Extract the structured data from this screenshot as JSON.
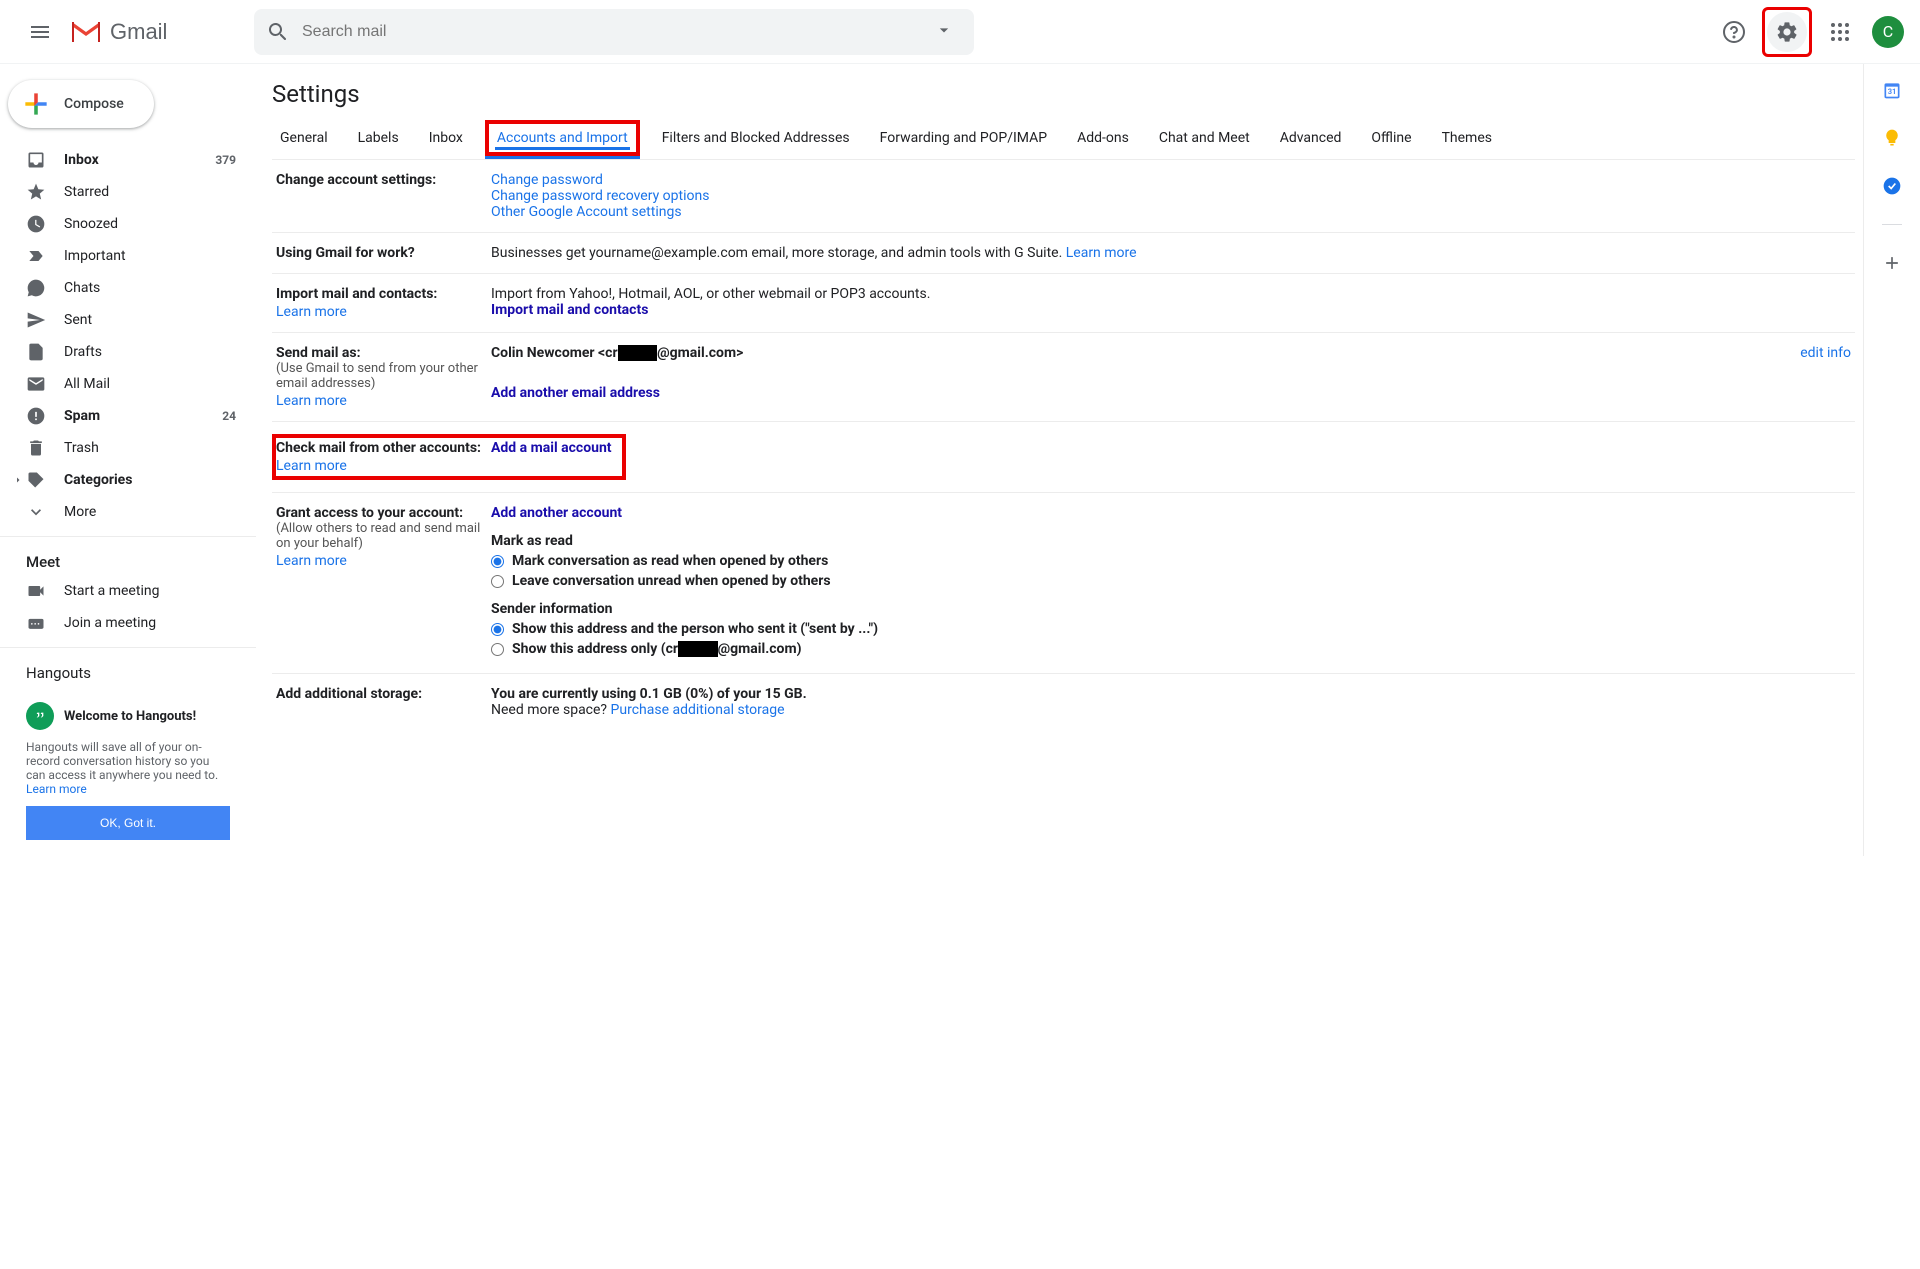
{
  "header": {
    "logo_text": "Gmail",
    "search_placeholder": "Search mail",
    "avatar_initial": "C"
  },
  "sidebar": {
    "compose": "Compose",
    "items": [
      {
        "label": "Inbox",
        "count": "379",
        "bold": true
      },
      {
        "label": "Starred"
      },
      {
        "label": "Snoozed"
      },
      {
        "label": "Important"
      },
      {
        "label": "Chats"
      },
      {
        "label": "Sent"
      },
      {
        "label": "Drafts"
      },
      {
        "label": "All Mail"
      },
      {
        "label": "Spam",
        "count": "24",
        "bold": true
      },
      {
        "label": "Trash"
      },
      {
        "label": "Categories",
        "bold": true,
        "expandable": true
      },
      {
        "label": "More",
        "expandable": true
      }
    ],
    "meet_heading": "Meet",
    "meet_items": [
      {
        "label": "Start a meeting"
      },
      {
        "label": "Join a meeting"
      }
    ],
    "hangouts_heading": "Hangouts",
    "hangouts_welcome": "Welcome to Hangouts!",
    "hangouts_desc": "Hangouts will save all of your on-record conversation history so you can access it anywhere you need to. ",
    "hangouts_learn": "Learn more",
    "hangouts_ok": "OK, Got it."
  },
  "main": {
    "title": "Settings",
    "tabs": [
      "General",
      "Labels",
      "Inbox",
      "Accounts and Import",
      "Filters and Blocked Addresses",
      "Forwarding and POP/IMAP",
      "Add-ons",
      "Chat and Meet",
      "Advanced",
      "Offline",
      "Themes"
    ],
    "rows": {
      "change_account": {
        "label": "Change account settings:",
        "links": [
          "Change password",
          "Change password recovery options",
          "Other Google Account settings"
        ]
      },
      "work": {
        "label": "Using Gmail for work?",
        "text": "Businesses get yourname@example.com email, more storage, and admin tools with G Suite. ",
        "learn": "Learn more"
      },
      "import": {
        "label": "Import mail and contacts:",
        "learn": "Learn more",
        "text": "Import from Yahoo!, Hotmail, AOL, or other webmail or POP3 accounts.",
        "link": "Import mail and contacts"
      },
      "send_as": {
        "label": "Send mail as:",
        "sub": "(Use Gmail to send from your other email addresses)",
        "learn": "Learn more",
        "name": "Colin Newcomer <cr",
        "domain": "@gmail.com>",
        "add": "Add another email address",
        "edit": "edit info"
      },
      "check_mail": {
        "label": "Check mail from other accounts:",
        "learn": "Learn more",
        "add": "Add a mail account"
      },
      "grant": {
        "label": "Grant access to your account:",
        "sub": "(Allow others to read and send mail on your behalf)",
        "learn": "Learn more",
        "add": "Add another account",
        "mark_heading": "Mark as read",
        "mark_opt1": "Mark conversation as read when opened by others",
        "mark_opt2": "Leave conversation unread when opened by others",
        "sender_heading": "Sender information",
        "sender_opt1": "Show this address and the person who sent it (\"sent by ...\")",
        "sender_opt2_pre": "Show this address only (cr",
        "sender_opt2_post": "@gmail.com)"
      },
      "storage": {
        "label": "Add additional storage:",
        "text": "You are currently using 0.1 GB (0%) of your 15 GB.",
        "more": "Need more space? ",
        "link": "Purchase additional storage"
      }
    }
  }
}
